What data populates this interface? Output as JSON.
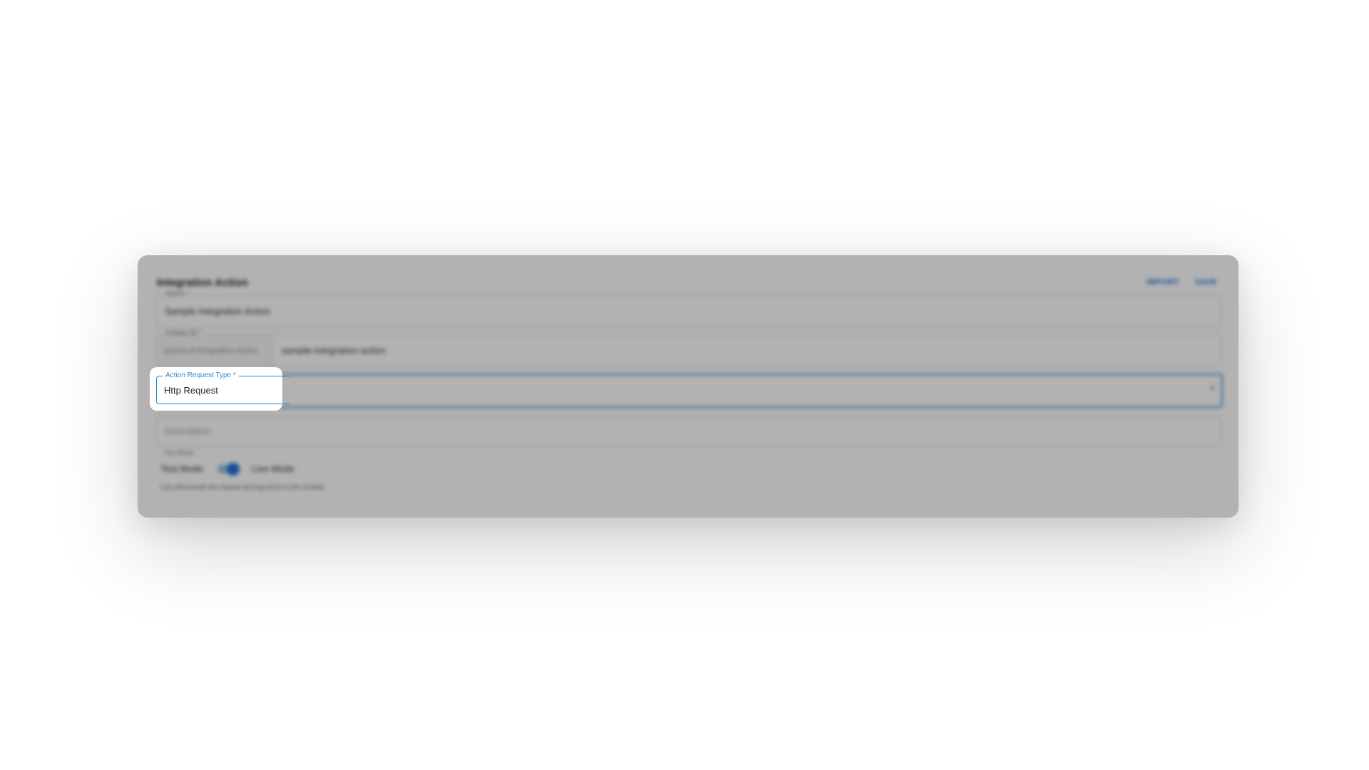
{
  "form": {
    "title": "Integration Action",
    "import_label": "IMPORT",
    "save_label": "SAVE",
    "name": {
      "label": "Name *",
      "value": "Sample Integration Action"
    },
    "unique_id": {
      "label": "Unique ID *",
      "prefix": "quirna-ot-integration-action",
      "value": "sample-integration-action"
    },
    "action_request_type": {
      "label": "Action Request Type *",
      "value": "Http Request"
    },
    "description": {
      "placeholder": "Description"
    },
    "mode": {
      "label": "Test Mode",
      "left_label": "Test Mode",
      "right_label": "Live Mode",
      "enabled": true,
      "help_text": "Live will execute the request and log errors to the console"
    }
  },
  "colors": {
    "accent": "#2b8bd6",
    "button": "#1e6fd9"
  }
}
